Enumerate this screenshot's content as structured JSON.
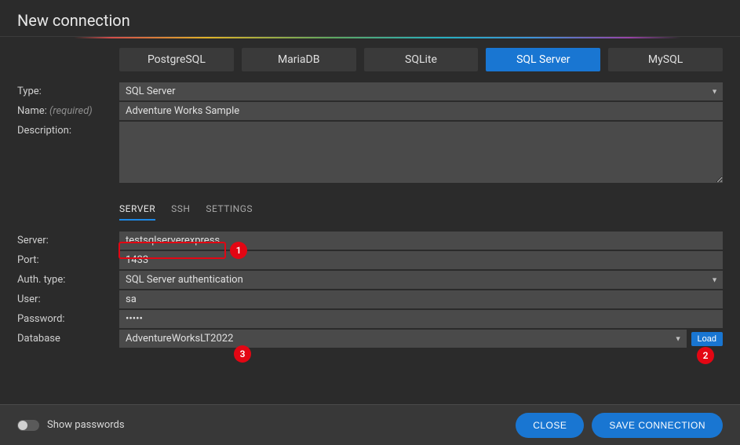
{
  "header": {
    "title": "New connection"
  },
  "dbtypes": {
    "items": [
      "PostgreSQL",
      "MariaDB",
      "SQLite",
      "SQL Server",
      "MySQL"
    ],
    "active": 3
  },
  "form": {
    "type_label": "Type:",
    "type_value": "SQL Server",
    "name_label": "Name:",
    "name_hint": "(required)",
    "name_value": "Adventure Works Sample",
    "description_label": "Description:",
    "description_value": ""
  },
  "tabs": {
    "items": [
      "SERVER",
      "SSH",
      "SETTINGS"
    ],
    "active": 0
  },
  "server": {
    "server_label": "Server:",
    "server_value": "testsqlserverexpress",
    "port_label": "Port:",
    "port_value": "1433",
    "auth_label": "Auth. type:",
    "auth_value": "SQL Server authentication",
    "user_label": "User:",
    "user_value": "sa",
    "password_label": "Password:",
    "password_value": "•••••",
    "database_label": "Database",
    "database_value": "AdventureWorksLT2022",
    "load_label": "Load"
  },
  "footer": {
    "show_passwords": "Show passwords",
    "close": "CLOSE",
    "save": "SAVE CONNECTION"
  },
  "annotations": {
    "n1": "1",
    "n2": "2",
    "n3": "3"
  }
}
